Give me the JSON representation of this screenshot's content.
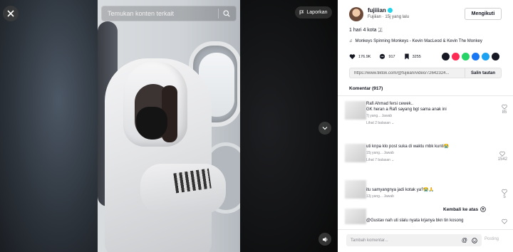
{
  "player": {
    "search_placeholder": "Temukan konten terkait",
    "report_label": "Laporkan"
  },
  "author": {
    "name": "fujiiian",
    "meta": "Fujiiian · 15j yang lalu",
    "follow_label": "Mengikuti"
  },
  "caption": "1 hari 4 kota 🇯",
  "music": "Monkeys Spinning Monkeys - Kevin MacLeod & Kevin The Monkey",
  "stats": {
    "likes": "176.9K",
    "comments": "917",
    "saves": "3255"
  },
  "share_icons": [
    "embed-icon",
    "send-icon",
    "whatsapp-icon",
    "facebook-icon",
    "twitter-icon",
    "share-icon"
  ],
  "link": {
    "url": "https://www.tiktok.com/@fujiiian/video/72642324...",
    "copy_label": "Salin tautan"
  },
  "comments": {
    "header": "Komentar (917)",
    "items": [
      {
        "text": "Rafi Ahmad fersi cewek..\nGK heran a Rafi sayang bgt sama anak ini",
        "meta": "7j yang...  Jawab",
        "replies": "Lihat 2 balasan ⌄",
        "likes": "85"
      },
      {
        "text": "uti knpa klo post suka di waktu mbk kunti😭",
        "meta": "15j yang...  Jawab",
        "replies": "Lihat 7 balasan ⌄",
        "likes": "1542"
      },
      {
        "text": "itu samyangnya jadi kotak ya?😭🙏",
        "meta": "13j yang...  Jawab",
        "replies": "",
        "likes": "5"
      },
      {
        "text": "@Gustav nah uti slalu nyata krjanya bkn tin kosong",
        "meta": "",
        "replies": "",
        "likes": ""
      }
    ]
  },
  "back_to_top": "Kembali ke atas",
  "input": {
    "placeholder": "Tambah komentar...",
    "post_label": "Posting"
  }
}
